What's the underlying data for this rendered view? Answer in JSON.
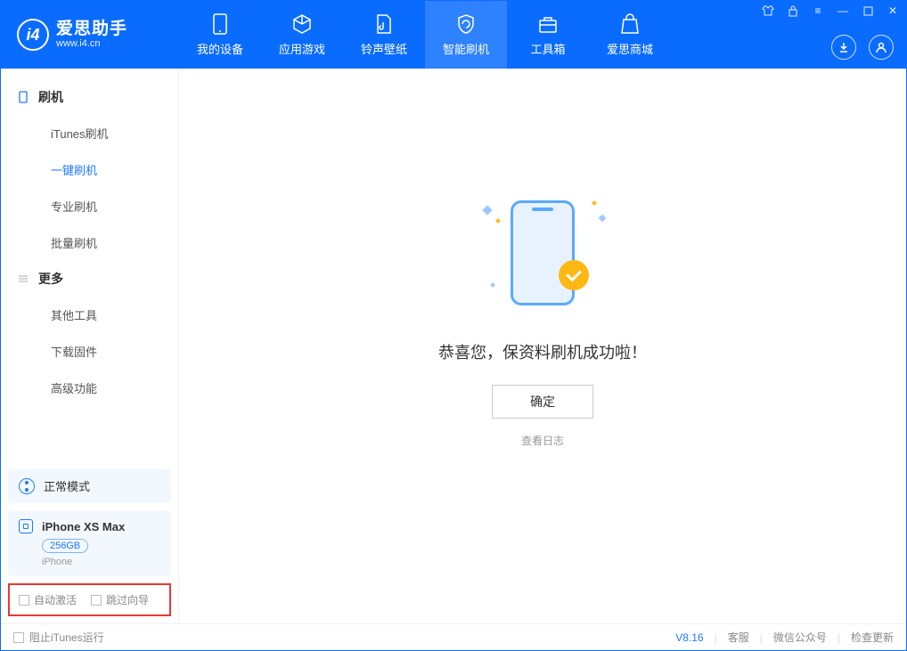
{
  "app": {
    "name_cn": "爱思助手",
    "name_en": "www.i4.cn"
  },
  "nav": {
    "items": [
      {
        "label": "我的设备"
      },
      {
        "label": "应用游戏"
      },
      {
        "label": "铃声壁纸"
      },
      {
        "label": "智能刷机"
      },
      {
        "label": "工具箱"
      },
      {
        "label": "爱思商城"
      }
    ]
  },
  "sidebar": {
    "section1_title": "刷机",
    "section1_items": [
      {
        "label": "iTunes刷机"
      },
      {
        "label": "一键刷机"
      },
      {
        "label": "专业刷机"
      },
      {
        "label": "批量刷机"
      }
    ],
    "section2_title": "更多",
    "section2_items": [
      {
        "label": "其他工具"
      },
      {
        "label": "下载固件"
      },
      {
        "label": "高级功能"
      }
    ],
    "mode_label": "正常模式",
    "device": {
      "name": "iPhone XS Max",
      "storage": "256GB",
      "type": "iPhone"
    },
    "cb_auto_activate": "自动激活",
    "cb_skip_guide": "跳过向导"
  },
  "main": {
    "success_text": "恭喜您，保资料刷机成功啦！",
    "ok_button": "确定",
    "view_log": "查看日志"
  },
  "statusbar": {
    "block_itunes": "阻止iTunes运行",
    "version": "V8.16",
    "links": [
      {
        "label": "客服"
      },
      {
        "label": "微信公众号"
      },
      {
        "label": "检查更新"
      }
    ]
  }
}
